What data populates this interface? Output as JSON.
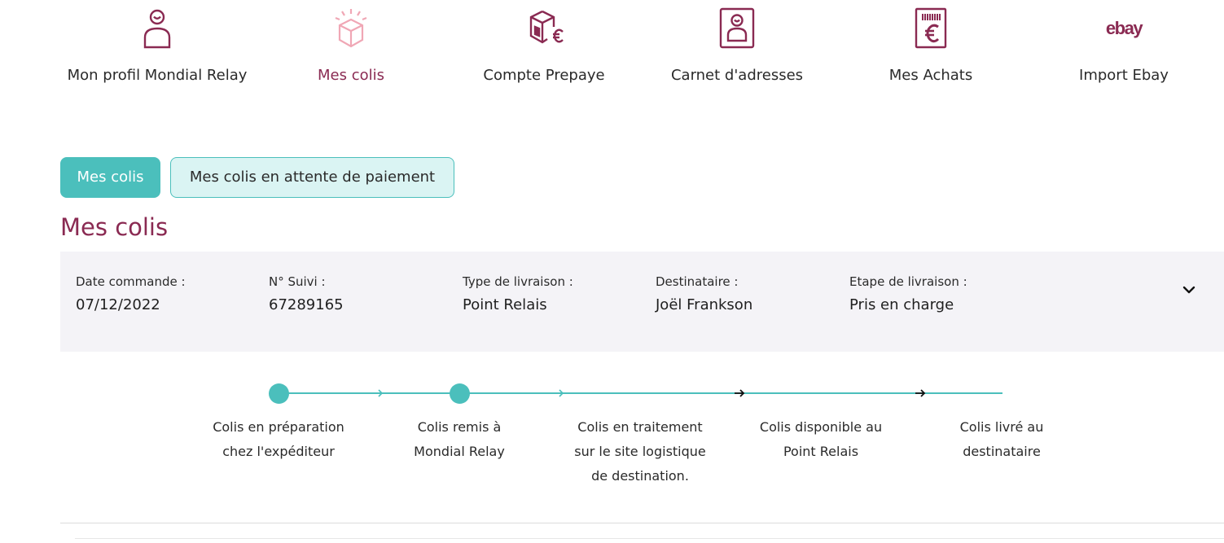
{
  "nav": {
    "items": [
      {
        "label": "Mon profil Mondial Relay",
        "icon": "profile-icon"
      },
      {
        "label": "Mes colis",
        "icon": "parcel-icon"
      },
      {
        "label": "Compte Prepaye",
        "icon": "prepaid-account-icon"
      },
      {
        "label": "Carnet d'adresses",
        "icon": "address-book-icon"
      },
      {
        "label": "Mes Achats",
        "icon": "purchases-icon"
      },
      {
        "label": "Import Ebay",
        "icon": "ebay-logo"
      }
    ],
    "ebay_logo_text": "ebay"
  },
  "tabs": {
    "active": "Mes colis",
    "inactive": "Mes colis en attente de paiement"
  },
  "page_title": "Mes colis",
  "order": {
    "date_label": "Date commande :",
    "date_value": "07/12/2022",
    "tracking_label": "N° Suivi :",
    "tracking_value": "67289165",
    "delivery_type_label": "Type de livraison :",
    "delivery_type_value": "Point Relais",
    "recipient_label": "Destinataire :",
    "recipient_value": "Joël Frankson",
    "step_label": "Etape de livraison :",
    "step_value": "Pris en charge"
  },
  "timeline": {
    "steps_completed": 2,
    "steps": [
      {
        "line1": "Colis en préparation",
        "line2": "chez l'expéditeur",
        "line3": ""
      },
      {
        "line1": "Colis remis à",
        "line2": "Mondial Relay",
        "line3": ""
      },
      {
        "line1": "Colis en traitement",
        "line2": "sur le site logistique",
        "line3": "de destination."
      },
      {
        "line1": "Colis disponible au",
        "line2": "Point Relais",
        "line3": ""
      },
      {
        "line1": "Colis livré au",
        "line2": "destinataire",
        "line3": ""
      }
    ]
  },
  "colors": {
    "brand": "#8a2a52",
    "accent": "#4bbfbc",
    "accent_light": "#daf4f3",
    "panel_bg": "#f4f3f7",
    "parcel_icon_pink": "#f0a7b5"
  }
}
